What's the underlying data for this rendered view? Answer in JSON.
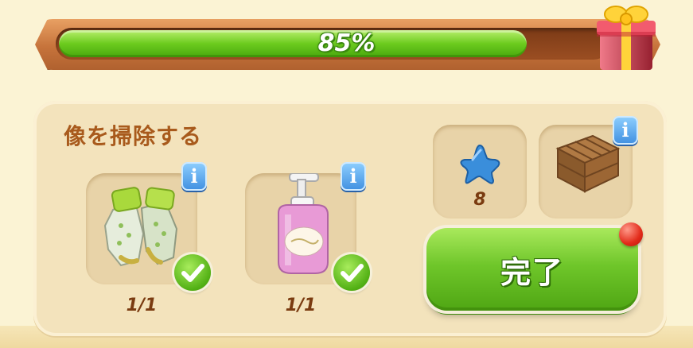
{
  "progress": {
    "percent_label": "85%",
    "fraction": 0.85
  },
  "gift_icon": "gift-box-icon",
  "task": {
    "title": "像を掃除する",
    "requirements": [
      {
        "name": "gloves",
        "icon": "gloves-icon",
        "count": "1/1",
        "completed": true
      },
      {
        "name": "soap-bottle",
        "icon": "soap-bottle-icon",
        "count": "1/1",
        "completed": true
      }
    ],
    "rewards": [
      {
        "name": "star",
        "icon": "blue-star-icon",
        "amount": "8"
      },
      {
        "name": "crate",
        "icon": "wooden-crate-icon"
      }
    ],
    "complete_button": "完了"
  },
  "colors": {
    "accent_green": "#6fc62a",
    "title_brown": "#a85a1c",
    "info_blue": "#3f8fe0",
    "alert_red": "#e22b1a"
  }
}
